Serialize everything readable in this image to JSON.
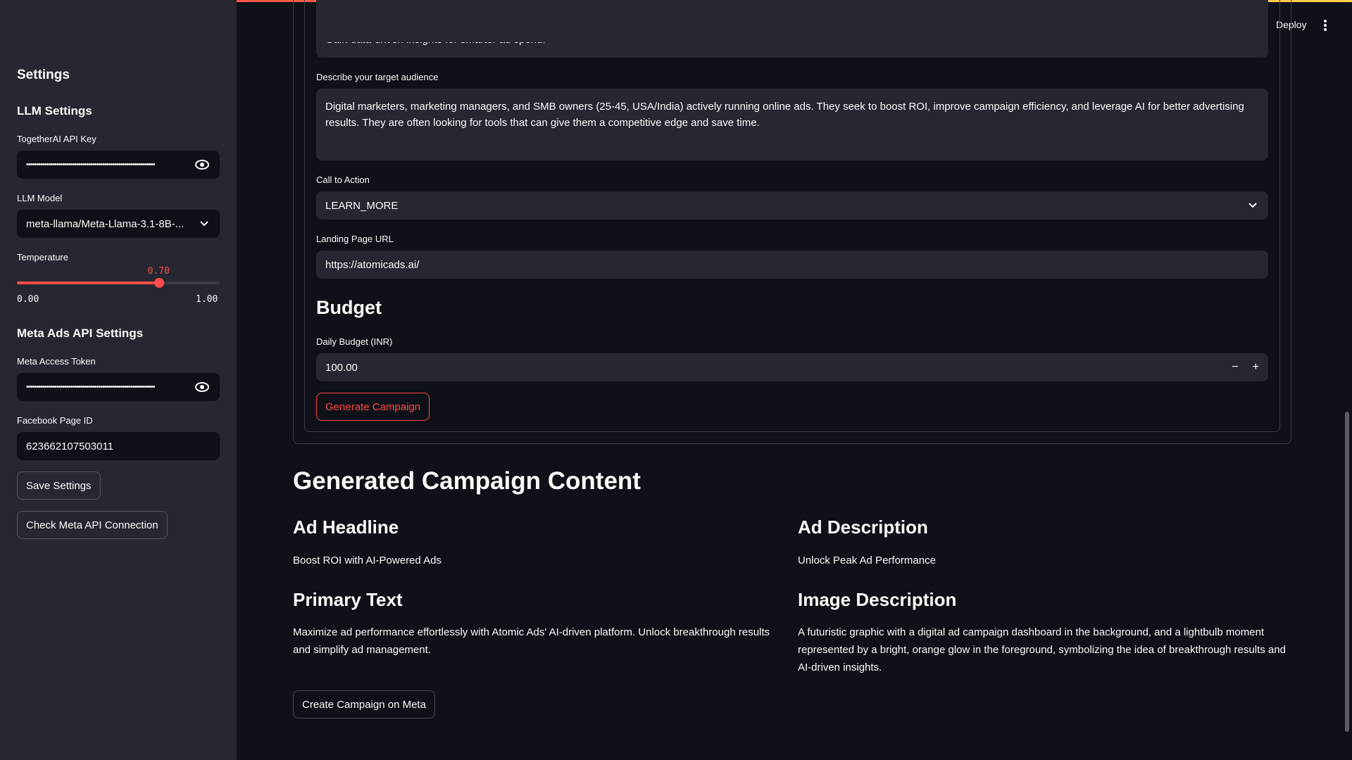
{
  "header": {
    "deploy_label": "Deploy"
  },
  "sidebar": {
    "title": "Settings",
    "llm_section": "LLM Settings",
    "api_key_label": "TogetherAI API Key",
    "api_key_value": "••••••••••••••••••••••••••••••••••••••••••••••••••••••••••••••••",
    "model_label": "LLM Model",
    "model_value": "meta-llama/Meta-Llama-3.1-8B-...",
    "temperature_label": "Temperature",
    "temperature_value": "0.70",
    "temperature_level": 0.7,
    "temperature_min": "0.00",
    "temperature_max": "1.00",
    "meta_section": "Meta Ads API Settings",
    "token_label": "Meta Access Token",
    "token_value": "••••••••••••••••••••••••••••••••••••••••••••••••••••••••••••••••",
    "page_id_label": "Facebook Page ID",
    "page_id_value": "623662107503011",
    "save_button": "Save Settings",
    "check_button": "Check Meta API Connection"
  },
  "form": {
    "overflow_text": "Gain data-driven insights for smarter ad spend.",
    "audience_label": "Describe your target audience",
    "audience_value": "Digital marketers, marketing managers, and SMB owners (25-45, USA/India) actively running online ads. They seek to boost ROI, improve campaign efficiency, and leverage AI for better advertising results. They are often looking for tools that can give them a competitive edge and save time.",
    "cta_label": "Call to Action",
    "cta_value": "LEARN_MORE",
    "landing_label": "Landing Page URL",
    "landing_value": "https://atomicads.ai/",
    "budget_heading": "Budget",
    "budget_label": "Daily Budget (INR)",
    "budget_value": "100.00",
    "minus": "−",
    "plus": "+",
    "generate_button": "Generate Campaign"
  },
  "results": {
    "heading": "Generated Campaign Content",
    "headline_title": "Ad Headline",
    "headline_value": "Boost ROI with AI-Powered Ads",
    "description_title": "Ad Description",
    "description_value": "Unlock Peak Ad Performance",
    "primary_title": "Primary Text",
    "primary_value": "Maximize ad performance effortlessly with Atomic Ads' AI-driven platform. Unlock breakthrough results and simplify ad management.",
    "image_title": "Image Description",
    "image_value": "A futuristic graphic with a digital ad campaign dashboard in the background, and a lightbulb moment represented by a bright, orange glow in the foreground, symbolizing the idea of breakthrough results and AI-driven insights.",
    "create_button": "Create Campaign on Meta"
  },
  "colors": {
    "accent": "#ff4b4b",
    "background": "#0e1117",
    "sidebar": "#262730"
  }
}
